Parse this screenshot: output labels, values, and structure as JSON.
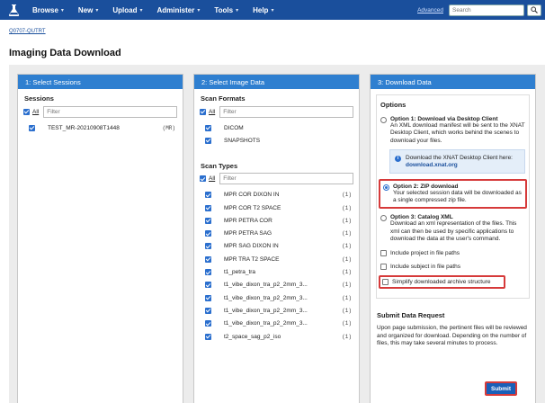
{
  "nav": {
    "logo_icon": "flask-logo-icon",
    "items": [
      "Browse",
      "New",
      "Upload",
      "Administer",
      "Tools",
      "Help"
    ],
    "advanced_label": "Advanced",
    "search_placeholder": "Search"
  },
  "breadcrumb": "Q0707-QUTRT",
  "page_title": "Imaging Data Download",
  "panel1": {
    "header": "1: Select Sessions",
    "sessions_label": "Sessions",
    "all_label": "All",
    "filter_placeholder": "Filter",
    "sessions": [
      {
        "name": "TEST_MR-20210908T1448",
        "tag": "(MR)",
        "checked": true
      }
    ]
  },
  "panel2": {
    "header": "2: Select Image Data",
    "formats_label": "Scan Formats",
    "all_label": "All",
    "filter_placeholder": "Filter",
    "formats": [
      {
        "name": "DICOM",
        "checked": true
      },
      {
        "name": "SNAPSHOTS",
        "checked": true
      }
    ],
    "types_label": "Scan Types",
    "types_all_label": "All",
    "types_filter_placeholder": "Filter",
    "scan_types": [
      {
        "name": "MPR COR DIXON IN",
        "count": "(1)"
      },
      {
        "name": "MPR COR T2 SPACE",
        "count": "(1)"
      },
      {
        "name": "MPR PETRA COR",
        "count": "(1)"
      },
      {
        "name": "MPR PETRA SAG",
        "count": "(1)"
      },
      {
        "name": "MPR SAG DIXON IN",
        "count": "(1)"
      },
      {
        "name": "MPR TRA T2 SPACE",
        "count": "(1)"
      },
      {
        "name": "t1_petra_tra",
        "count": "(1)"
      },
      {
        "name": "t1_vibe_dixon_tra_p2_2mm_3...",
        "count": "(1)"
      },
      {
        "name": "t1_vibe_dixon_tra_p2_2mm_3...",
        "count": "(1)"
      },
      {
        "name": "t1_vibe_dixon_tra_p2_2mm_3...",
        "count": "(1)"
      },
      {
        "name": "t1_vibe_dixon_tra_p2_2mm_3...",
        "count": "(1)"
      },
      {
        "name": "t2_space_sag_p2_iso",
        "count": "(1)"
      }
    ]
  },
  "panel3": {
    "header": "3: Download Data",
    "options_label": "Options",
    "option1_title": "Option 1: Download via Desktop Client",
    "option1_desc": "An XML download manifest will be sent to the XNAT Desktop Client, which works behind the scenes to download your files.",
    "info_text": "Download the XNAT Desktop Client here:",
    "info_link": "download.xnat.org",
    "option2_title": "Option 2: ZIP download",
    "option2_desc": "Your selected session data will be downloaded as a single compressed zip file.",
    "option3_title": "Option 3: Catalog XML",
    "option3_desc": "Download an xml representation of the files. This xml can then be used by specific applications to download the data at the user's command.",
    "check_project": "Include project in file paths",
    "check_subject": "Include subject in file paths",
    "check_simplify": "Simplify downloaded archive structure",
    "submit_title": "Submit Data Request",
    "submit_desc": "Upon page submission, the pertinent files will be reviewed and organized for download. Depending on the number of files, this may take several minutes to process.",
    "submit_label": "Submit"
  },
  "colors": {
    "nav_bg": "#1a4f9c",
    "panel_header": "#2f7fd0",
    "highlight": "#d63a3a",
    "checkbox": "#2b6fce"
  }
}
